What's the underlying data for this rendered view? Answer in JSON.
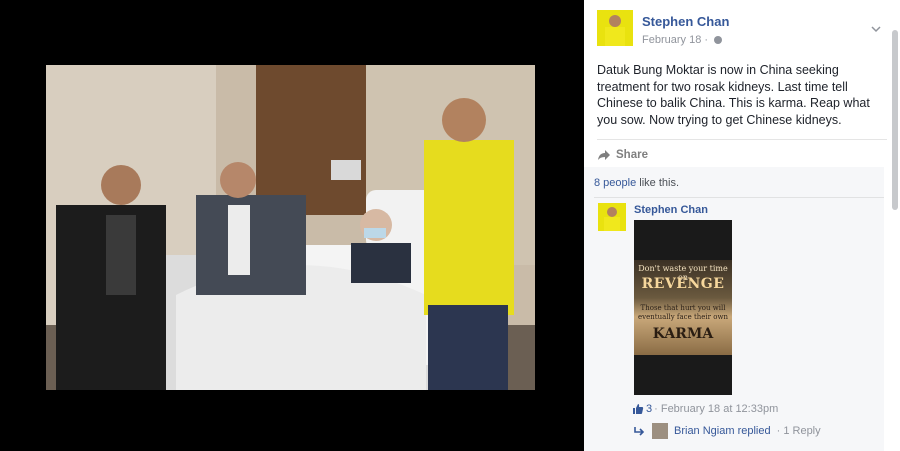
{
  "post": {
    "author": "Stephen Chan",
    "date": "February 18",
    "separator": "·",
    "text": "Datuk Bung Moktar is now in China seeking treatment for two rosak kidneys. Last time tell Chinese to balik China. This is karma. Reap what you sow. Now trying to get Chinese kidneys.",
    "share_label": "Share"
  },
  "likes": {
    "count_text": "8 people",
    "suffix": "like this."
  },
  "comment": {
    "author": "Stephen Chan",
    "image_text": {
      "line1": "Don't waste your time on",
      "line2": "REVENGE",
      "line3": "Those that hurt you will eventually face their own",
      "line4": "KARMA"
    },
    "like_count": "3",
    "timestamp": "· February 18 at 12:33pm",
    "reply_author": "Brian Ngiam replied",
    "reply_count": "· 1 Reply"
  },
  "icons": [
    "globe-icon",
    "chevron-down-icon",
    "share-icon",
    "thumbs-up-icon",
    "reply-arrow-icon"
  ],
  "colors": {
    "link": "#365899",
    "muted": "#90949c",
    "panel_bg": "#ffffff",
    "feedback_bg": "#f6f7f9",
    "viewer_bg": "#000000"
  }
}
